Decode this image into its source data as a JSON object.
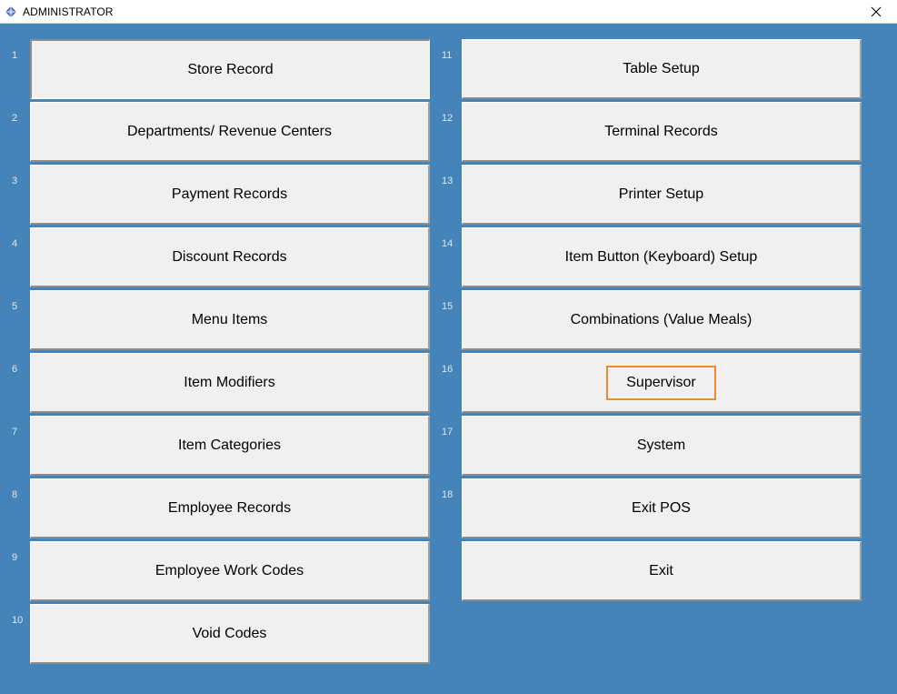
{
  "window": {
    "title": "ADMINISTRATOR",
    "close_glyph": "✕"
  },
  "buttons_left": [
    {
      "num": "1",
      "label": "Store Record"
    },
    {
      "num": "2",
      "label": "Departments/ Revenue Centers"
    },
    {
      "num": "3",
      "label": "Payment Records"
    },
    {
      "num": "4",
      "label": "Discount Records"
    },
    {
      "num": "5",
      "label": "Menu Items"
    },
    {
      "num": "6",
      "label": "Item Modifiers"
    },
    {
      "num": "7",
      "label": "Item Categories"
    },
    {
      "num": "8",
      "label": "Employee Records"
    },
    {
      "num": "9",
      "label": "Employee Work Codes"
    },
    {
      "num": "10",
      "label": "Void Codes"
    }
  ],
  "buttons_right": [
    {
      "num": "11",
      "label": "Table Setup"
    },
    {
      "num": "12",
      "label": "Terminal Records"
    },
    {
      "num": "13",
      "label": "Printer Setup"
    },
    {
      "num": "14",
      "label": "Item Button (Keyboard) Setup"
    },
    {
      "num": "15",
      "label": "Combinations (Value Meals)"
    },
    {
      "num": "16",
      "label": "Supervisor"
    },
    {
      "num": "17",
      "label": "System"
    },
    {
      "num": "18",
      "label": "Exit POS"
    },
    {
      "num": "",
      "label": "Exit"
    }
  ],
  "focused_button": "Supervisor",
  "colors": {
    "background": "#4584b8",
    "button_face": "#f0f0f0",
    "focus_outline": "#f0892e"
  }
}
